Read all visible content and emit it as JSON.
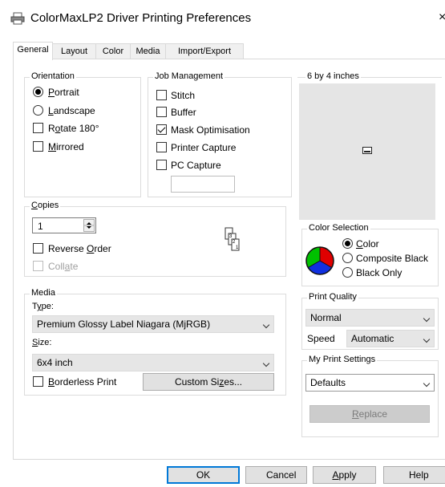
{
  "window": {
    "title": "ColorMaxLP2 Driver Printing Preferences",
    "close_glyph": "×",
    "icon": "printer-icon"
  },
  "tabs": [
    "General",
    "Layout",
    "Color",
    "Media",
    "Import/Export"
  ],
  "active_tab": "General",
  "orientation": {
    "label": "Orientation",
    "portrait": "Portrait",
    "landscape": "Landscape",
    "rotate": "Rotate 180°",
    "mirrored": "Mirrored",
    "selected": "Portrait",
    "rotate_checked": false,
    "mirrored_checked": false
  },
  "job_management": {
    "label": "Job Management",
    "items": [
      {
        "label": "Stitch",
        "checked": false
      },
      {
        "label": "Buffer",
        "checked": false
      },
      {
        "label": "Mask Optimisation",
        "checked": true
      },
      {
        "label": "Printer Capture",
        "checked": false
      },
      {
        "label": "PC Capture",
        "checked": false
      }
    ],
    "capture_field": ""
  },
  "preview": {
    "label": "6 by 4 inches"
  },
  "copies": {
    "label": "Copies",
    "value": "1",
    "reverse_order": "Reverse Order",
    "collate": "Collate",
    "reverse_checked": false,
    "collate_disabled": true
  },
  "collate_icon_pages": [
    "3",
    "2",
    "1"
  ],
  "color_selection": {
    "label": "Color Selection",
    "options": [
      "Color",
      "Composite Black",
      "Black Only"
    ],
    "selected": "Color",
    "wheel_colors": [
      "#e00000",
      "#00c000",
      "#1030e0"
    ]
  },
  "media": {
    "label": "Media",
    "type_label": "Type:",
    "type_value": "Premium Glossy Label Niagara (MjRGB)",
    "size_label": "Size:",
    "size_value": "6x4 inch",
    "borderless": "Borderless Print",
    "borderless_checked": false,
    "custom_sizes": "Custom Sizes..."
  },
  "print_quality": {
    "label": "Print Quality",
    "value": "Normal",
    "speed_label": "Speed",
    "speed_value": "Automatic"
  },
  "my_print_settings": {
    "label": "My Print Settings",
    "value": "Defaults",
    "replace": "Replace"
  },
  "buttons": {
    "ok": "OK",
    "cancel": "Cancel",
    "apply": "Apply",
    "help": "Help"
  }
}
